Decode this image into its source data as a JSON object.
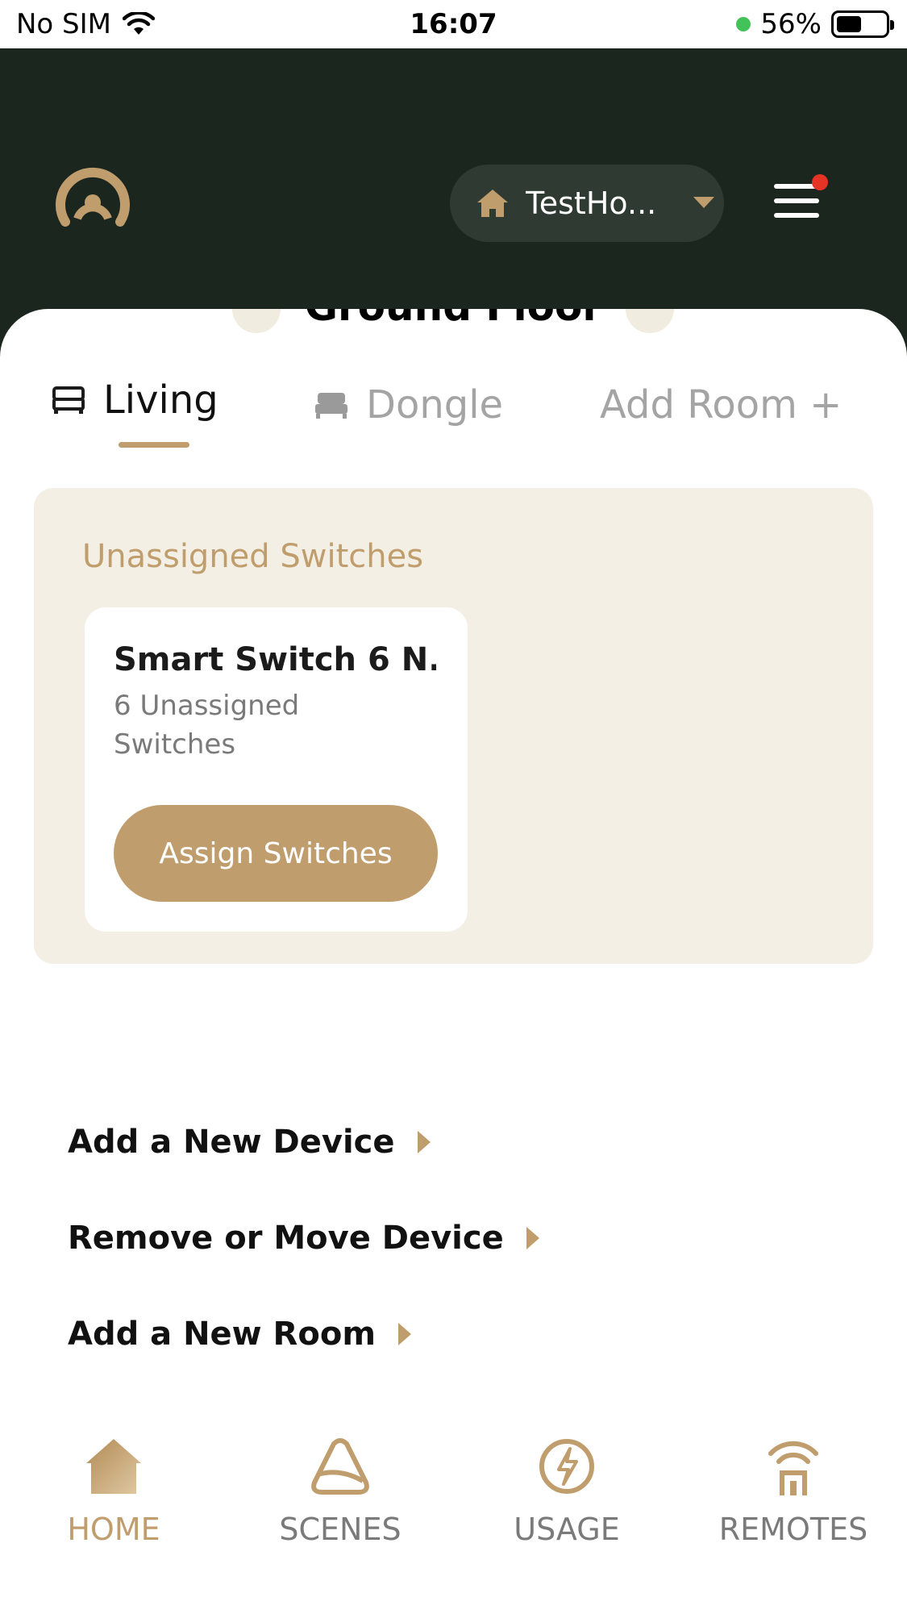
{
  "status_bar": {
    "carrier": "No SIM",
    "time": "16:07",
    "battery": "56%"
  },
  "header": {
    "home_name": "TestHo...",
    "has_notification": true
  },
  "floor": {
    "name": "Ground Floor"
  },
  "tabs": [
    {
      "label": "Living",
      "active": true
    },
    {
      "label": "Dongle",
      "active": false
    },
    {
      "label": "Add Room +",
      "active": false
    }
  ],
  "unassigned": {
    "title": "Unassigned Switches",
    "card": {
      "name": "Smart Switch 6 N...",
      "subtitle": "6 Unassigned Switches",
      "button": "Assign Switches"
    }
  },
  "actions": [
    {
      "label": "Add a New Device"
    },
    {
      "label": "Remove or Move Device"
    },
    {
      "label": "Add a New Room"
    }
  ],
  "bottom_nav": [
    {
      "label": "HOME",
      "icon": "home-icon",
      "active": true
    },
    {
      "label": "SCENES",
      "icon": "scenes-icon",
      "active": false
    },
    {
      "label": "USAGE",
      "icon": "usage-icon",
      "active": false
    },
    {
      "label": "REMOTES",
      "icon": "remotes-icon",
      "active": false
    }
  ],
  "colors": {
    "header_bg": "#1b261f",
    "accent": "#c09d6d",
    "panel_bg": "#f3efe4",
    "inactive": "#7a7a7a"
  }
}
